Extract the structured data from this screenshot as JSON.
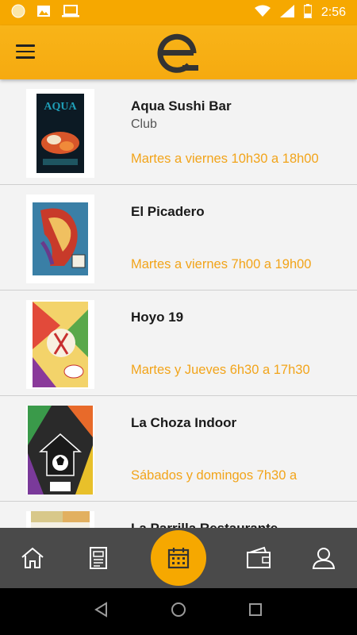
{
  "status_bar": {
    "time": "2:56",
    "icons": [
      "circle-notification-icon",
      "image-icon",
      "laptop-icon",
      "wifi-icon",
      "signal-icon",
      "battery-icon"
    ]
  },
  "app_bar": {
    "logo_icon": "brand-e-logo-icon",
    "menu_icon": "hamburger-menu-icon"
  },
  "colors": {
    "accent": "#f6a800",
    "hours_text": "#f2a41a",
    "nav_bg": "#4a4a4a"
  },
  "venues": [
    {
      "name": "Aqua Sushi Bar",
      "category": "Club",
      "hours": "Martes a viernes 10h30 a 18h00"
    },
    {
      "name": "El Picadero",
      "category": "",
      "hours": "Martes a viernes 7h00 a 19h00"
    },
    {
      "name": "Hoyo 19",
      "category": "",
      "hours": "Martes y Jueves 6h30 a 17h30"
    },
    {
      "name": "La Choza Indoor",
      "category": "",
      "hours": "Sábados y domingos 7h30 a"
    },
    {
      "name": "La Parrilla Restaurante",
      "category": "",
      "hours": ""
    }
  ],
  "bottom_nav": {
    "items": [
      "home-icon",
      "news-icon",
      "calendar-icon",
      "wallet-icon",
      "profile-icon"
    ]
  },
  "system_nav": [
    "back-icon",
    "home-circle-icon",
    "recents-icon"
  ]
}
